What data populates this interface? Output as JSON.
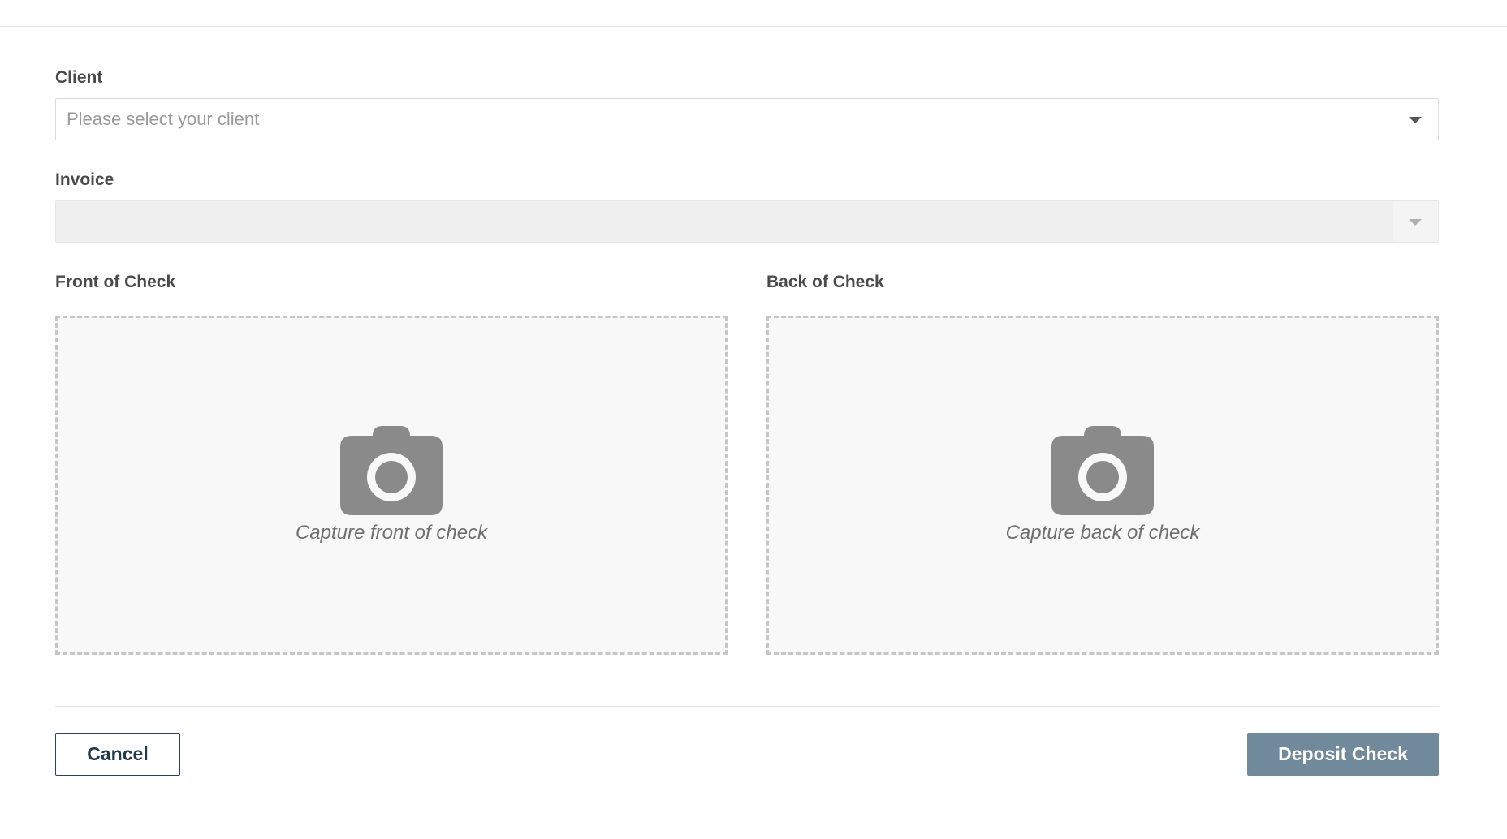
{
  "form": {
    "client": {
      "label": "Client",
      "placeholder": "Please select your client",
      "icon": "chevron-down-icon"
    },
    "invoice": {
      "label": "Invoice",
      "value": "",
      "disabled": true,
      "icon": "chevron-down-icon"
    },
    "front": {
      "label": "Front of Check",
      "caption": "Capture front of check",
      "icon": "camera-icon"
    },
    "back": {
      "label": "Back of Check",
      "caption": "Capture back of check",
      "icon": "camera-icon"
    }
  },
  "actions": {
    "cancel_label": "Cancel",
    "deposit_label": "Deposit Check"
  },
  "colors": {
    "primary_button": "#718a9b",
    "cancel_border": "#2d4257",
    "dropzone_border": "#c6c6c6",
    "icon": "#8a8a8a"
  }
}
